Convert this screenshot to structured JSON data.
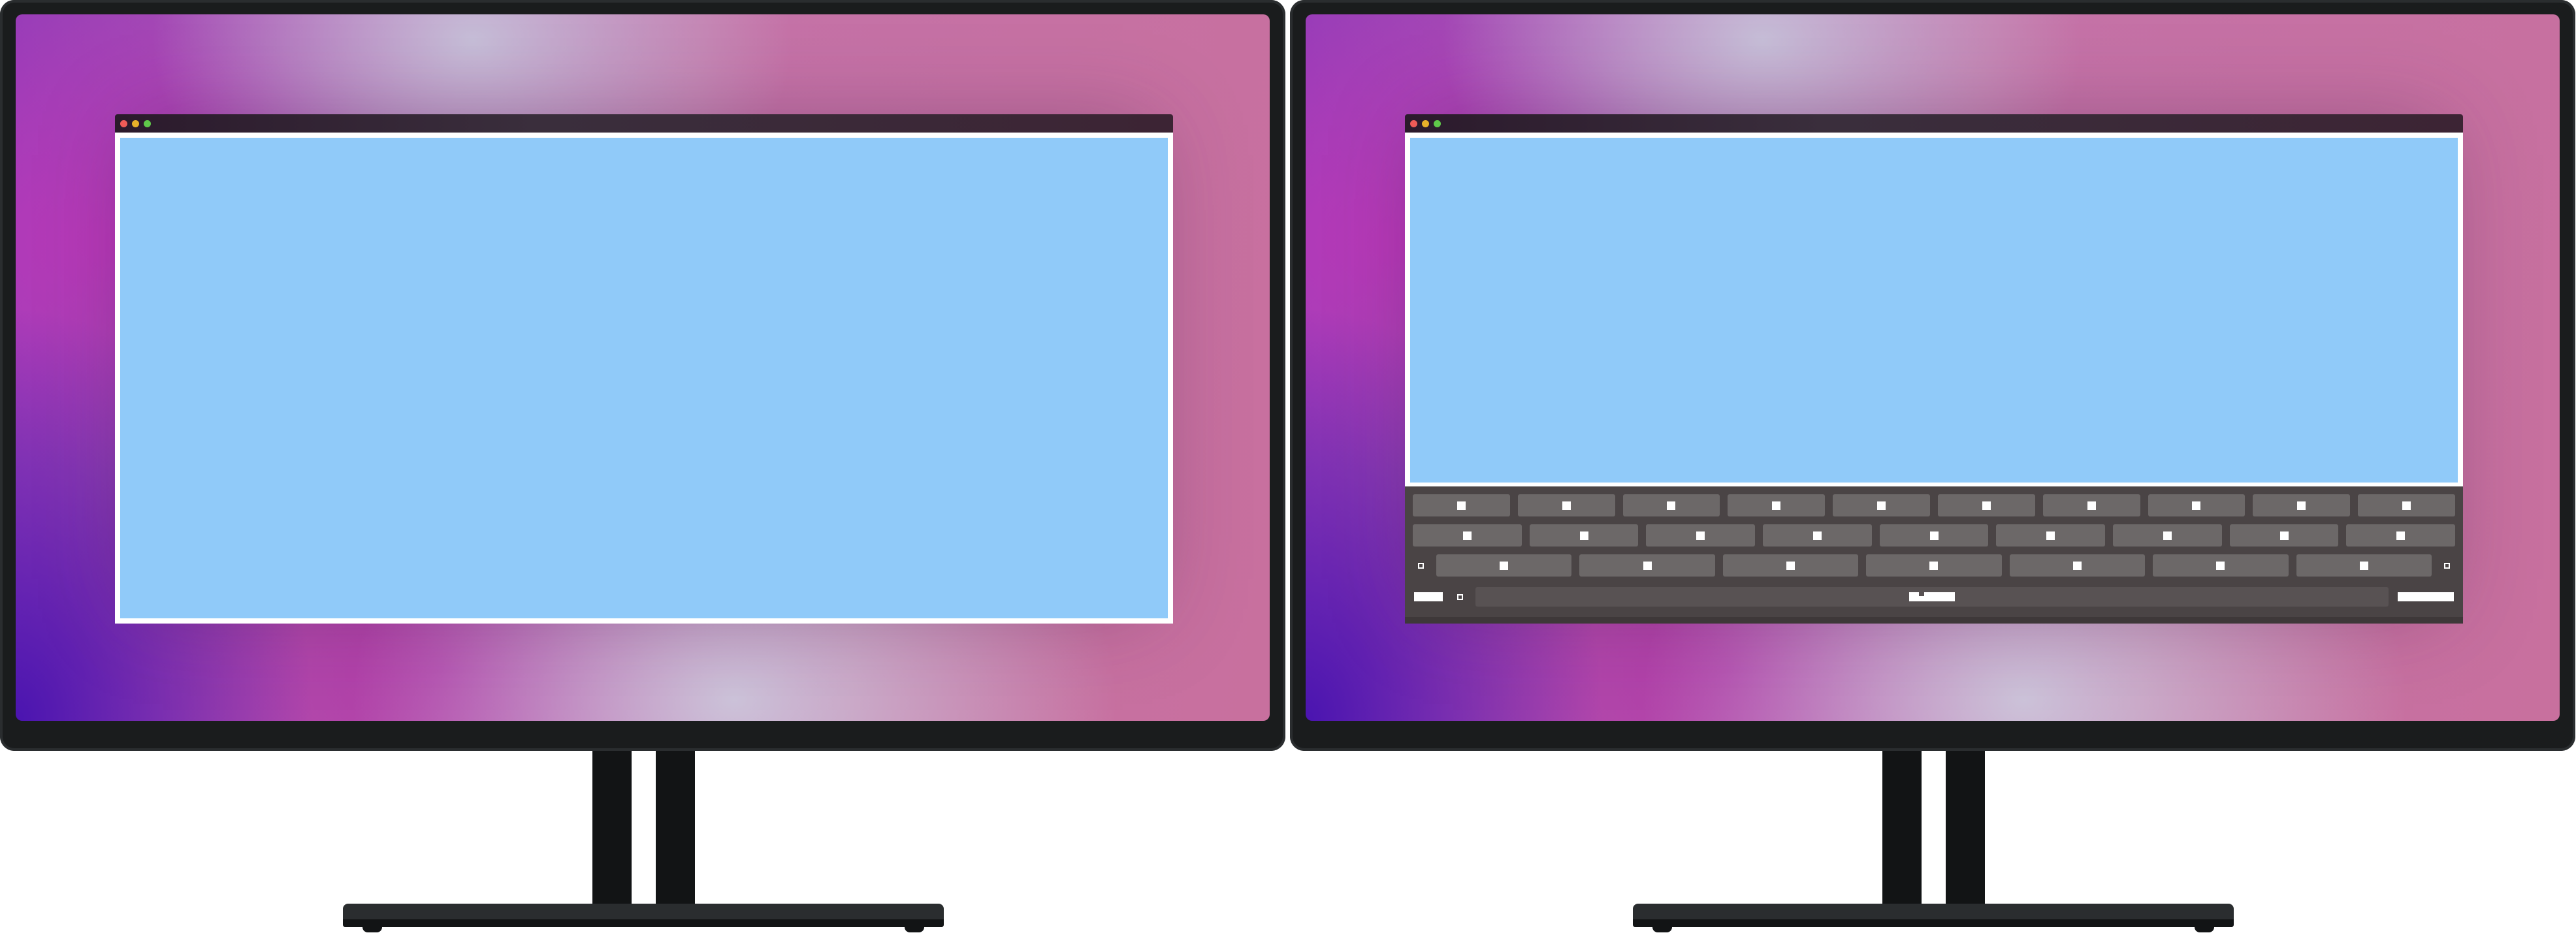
{
  "monitors": [
    {
      "id": "left",
      "window": {
        "has_keyboard": false
      },
      "colors": {
        "content": "#90caf9",
        "titlebar": "#2b1a2c"
      }
    },
    {
      "id": "right",
      "window": {
        "has_keyboard": true
      },
      "keyboard": {
        "rows": [
          {
            "keys": 10,
            "left_modifier": "",
            "right_modifier": ""
          },
          {
            "keys": 9,
            "left_modifier": "",
            "right_modifier": ""
          },
          {
            "keys": 7,
            "left_modifier": "square-outline",
            "right_modifier": "square-outline"
          },
          {
            "keys": 0,
            "left_modifier": "bar",
            "right_modifier": "wide-bar",
            "space": true
          }
        ]
      },
      "colors": {
        "content": "#90caf9",
        "keyboard_bg": "#4a4445",
        "key": "#6c6868"
      }
    }
  ],
  "traffic_lights": [
    "close",
    "minimize",
    "maximize"
  ]
}
